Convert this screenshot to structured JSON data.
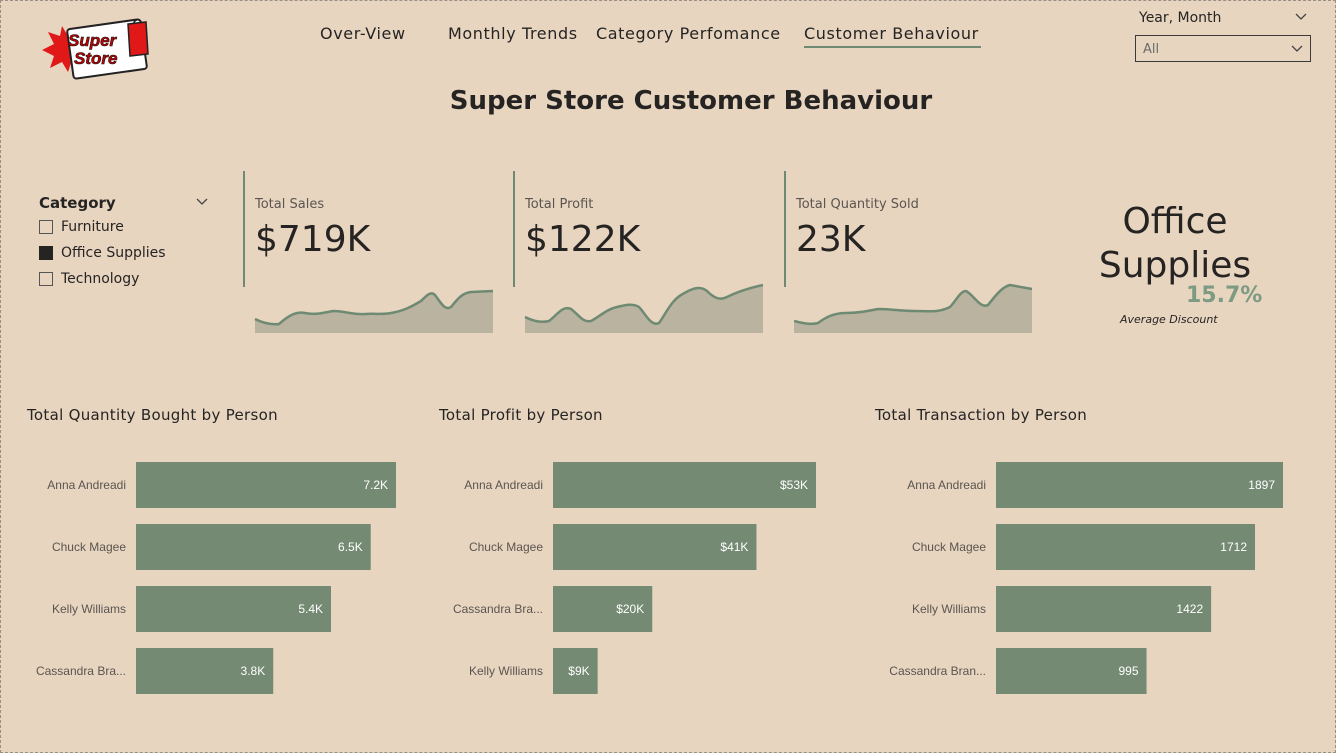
{
  "logo": {
    "line1": "Super",
    "line2": "Store"
  },
  "nav": {
    "tabs": [
      {
        "label": "Over-View"
      },
      {
        "label": "Monthly Trends"
      },
      {
        "label": "Category Perfomance"
      },
      {
        "label": "Customer Behaviour"
      }
    ],
    "active": "Customer Behaviour"
  },
  "slicer": {
    "title": "Year, Month",
    "value": "All"
  },
  "page_title": "Super Store Customer Behaviour",
  "category_slicer": {
    "title": "Category",
    "items": [
      {
        "label": "Furniture",
        "checked": false
      },
      {
        "label": "Office Supplies",
        "checked": true
      },
      {
        "label": "Technology",
        "checked": false
      }
    ]
  },
  "kpis": [
    {
      "label": "Total Sales",
      "value": "$719K"
    },
    {
      "label": "Total Profit",
      "value": "$122K"
    },
    {
      "label": "Total Quantity Sold",
      "value": "23K"
    }
  ],
  "selected_category": {
    "line1": "Office",
    "line2": "Supplies",
    "avg_discount": "15.7%",
    "avg_label": "Average Discount"
  },
  "colors": {
    "background": "#e8d5c0",
    "bar": "#748a73",
    "accent": "#6e8a73",
    "area": "#bab3a0"
  },
  "chart_data": [
    {
      "type": "bar",
      "title": "Total Quantity Bought by Person",
      "categories": [
        "Anna Andreadi",
        "Chuck Magee",
        "Kelly Williams",
        "Cassandra Bra..."
      ],
      "values": [
        7200,
        6500,
        5400,
        3800
      ],
      "labels": [
        "7.2K",
        "6.5K",
        "5.4K",
        "3.8K"
      ],
      "xlim": [
        0,
        7200
      ]
    },
    {
      "type": "bar",
      "title": "Total Profit by Person",
      "categories": [
        "Anna Andreadi",
        "Chuck Magee",
        "Cassandra Bra...",
        "Kelly Williams"
      ],
      "values": [
        53000,
        41000,
        20000,
        9000
      ],
      "labels": [
        "$53K",
        "$41K",
        "$20K",
        "$9K"
      ],
      "xlim": [
        0,
        53000
      ]
    },
    {
      "type": "bar",
      "title": "Total Transaction by Person",
      "categories": [
        "Anna Andreadi",
        "Chuck Magee",
        "Kelly Williams",
        "Cassandra Bran..."
      ],
      "values": [
        1897,
        1712,
        1422,
        995
      ],
      "labels": [
        "1897",
        "1712",
        "1422",
        "995"
      ],
      "xlim": [
        0,
        1897
      ]
    }
  ]
}
